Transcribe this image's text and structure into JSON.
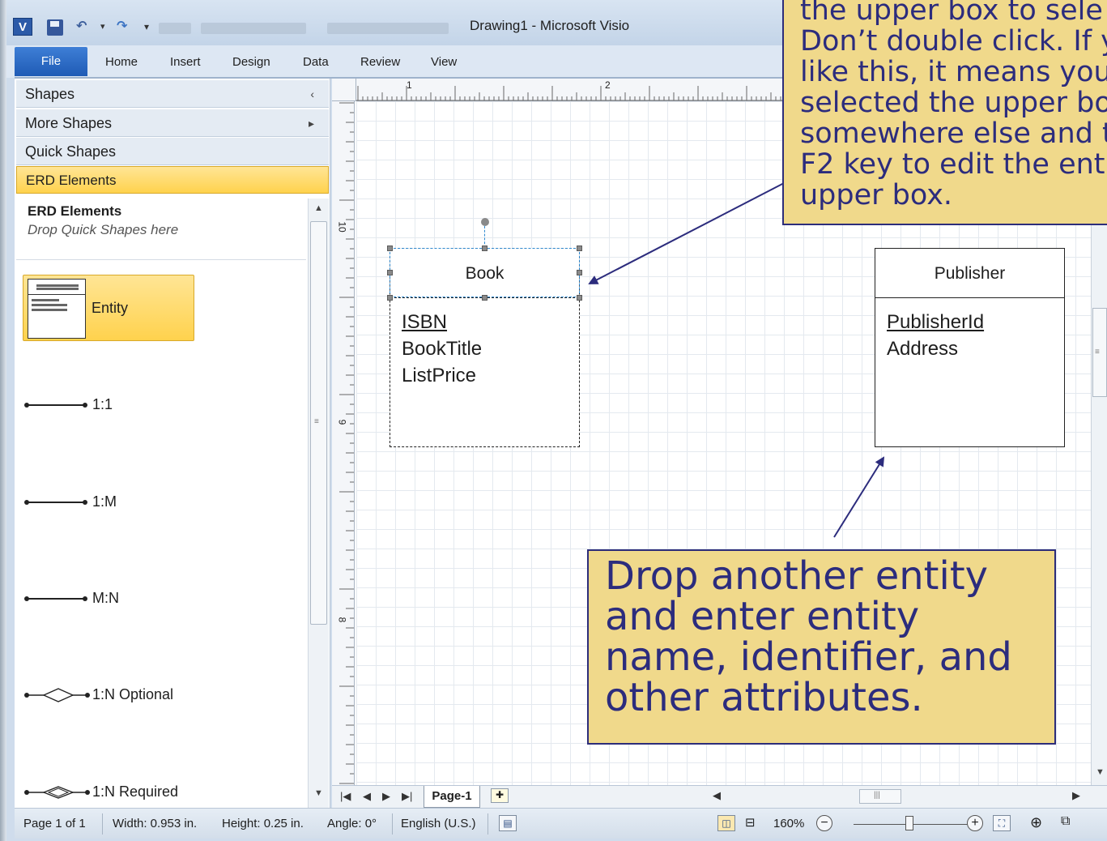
{
  "title_bar": {
    "window_title": "Drawing1  -  Microsoft Visio",
    "app_icon": "visio-logo-icon"
  },
  "ribbon": {
    "file_tab": "File",
    "tabs": [
      "Home",
      "Insert",
      "Design",
      "Data",
      "Review",
      "View"
    ]
  },
  "shapes_pane": {
    "header": "Shapes",
    "more_shapes": "More Shapes",
    "quick_shapes": "Quick Shapes",
    "erd_elements": "ERD Elements",
    "stencil_title": "ERD Elements",
    "stencil_hint": "Drop Quick Shapes here",
    "masters": {
      "entity": "Entity",
      "one_to_one": "1:1",
      "one_to_many": "1:M",
      "many_to_many": "M:N",
      "one_to_n_optional": "1:N Optional",
      "one_to_n_required": "1:N Required"
    }
  },
  "rulers": {
    "top": [
      "1",
      "2"
    ],
    "left": [
      "10",
      "9",
      "8"
    ]
  },
  "canvas": {
    "book": {
      "name": "Book",
      "identifier": "ISBN",
      "attributes": [
        "BookTitle",
        "ListPrice"
      ]
    },
    "publisher": {
      "name": "Publisher",
      "identifier": "PublisherId",
      "attributes": [
        "Address"
      ]
    }
  },
  "callouts": {
    "top": "the upper box to sele\nDon’t double click. If y\nlike this, it means you\nselected the upper bo\nsomewhere else and t\nF2 key to edit the ent\nupper box.",
    "bottom": "Drop another entity\nand enter entity\nname, identifier, and\nother attributes."
  },
  "page_tabs": {
    "current": "Page-1"
  },
  "status_bar": {
    "page": "Page 1 of 1",
    "width": "Width: 0.953 in.",
    "height": "Height: 0.25 in.",
    "angle": "Angle: 0°",
    "language": "English (U.S.)",
    "zoom": "160%"
  },
  "colors": {
    "accent": "#1f5bb5",
    "callout_fill": "#f0d98b",
    "callout_text": "#2c2c7d",
    "highlight": "#ffd24d"
  }
}
